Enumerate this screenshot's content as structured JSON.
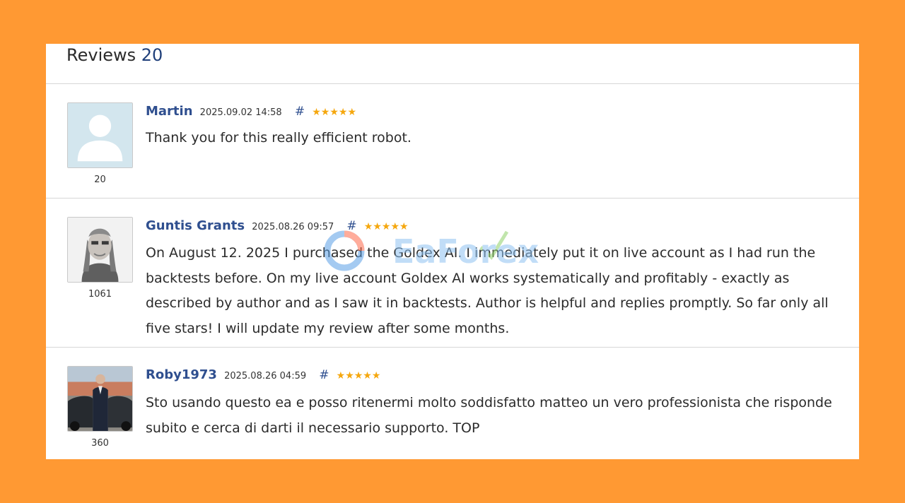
{
  "header": {
    "title": "Reviews",
    "count": "20"
  },
  "watermark": "EaForex",
  "reviews": [
    {
      "avatar_icon": "default-user-icon",
      "avatar_count": "20",
      "author": "Martin",
      "date": "2025.09.02 14:58",
      "hash": "#",
      "stars": "★★★★★",
      "rating": 5,
      "text": "Thank you for this really efficient robot."
    },
    {
      "avatar_icon": "user-photo",
      "avatar_count": "1061",
      "author": "Guntis Grants",
      "date": "2025.08.26 09:57",
      "hash": "#",
      "stars": "★★★★★",
      "rating": 5,
      "text": "On August 12. 2025 I purchased the Goldex AI. I immediately put it on live account as I had run the backtests before. On my live account Goldex AI works systematically and profitably - exactly as described by author and as I saw it in backtests. Author is helpful and replies promptly. So far only all five stars! I will update my review after some months."
    },
    {
      "avatar_icon": "user-photo",
      "avatar_count": "360",
      "author": "Roby1973",
      "date": "2025.08.26 04:59",
      "hash": "#",
      "stars": "★★★★★",
      "rating": 5,
      "text": "Sto usando questo ea e posso ritenermi molto soddisfatto matteo un vero professionista che risponde subito e cerca di darti il necessario supporto. TOP"
    }
  ]
}
